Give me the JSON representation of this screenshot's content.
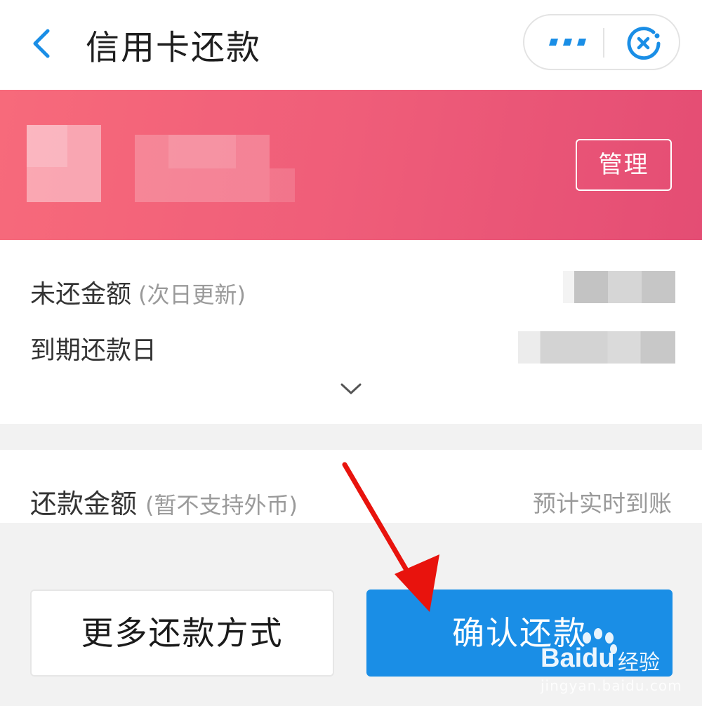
{
  "header": {
    "title": "信用卡还款",
    "back_icon": "chevron-left-icon",
    "more_icon": "more-dots-icon",
    "close_icon": "close-mini-program-icon"
  },
  "card_banner": {
    "manage_label": "管理"
  },
  "bill_info": {
    "outstanding_label": "未还金额",
    "outstanding_note": "(次日更新)",
    "due_date_label": "到期还款日",
    "expand_icon": "chevron-down-icon"
  },
  "repayment": {
    "amount_label": "还款金额",
    "amount_note": "(暂不支持外币)",
    "arrival_text": "预计实时到账"
  },
  "actions": {
    "more_methods_label": "更多还款方式",
    "confirm_label": "确认还款"
  },
  "watermark": {
    "brand": "Bai",
    "brand_suffix": "du",
    "product": "经验",
    "url": "jingyan.baidu.com"
  },
  "colors": {
    "accent_blue": "#1a8ee6",
    "banner_pink": "#ef5d79",
    "annotation_red": "#e8130d"
  }
}
